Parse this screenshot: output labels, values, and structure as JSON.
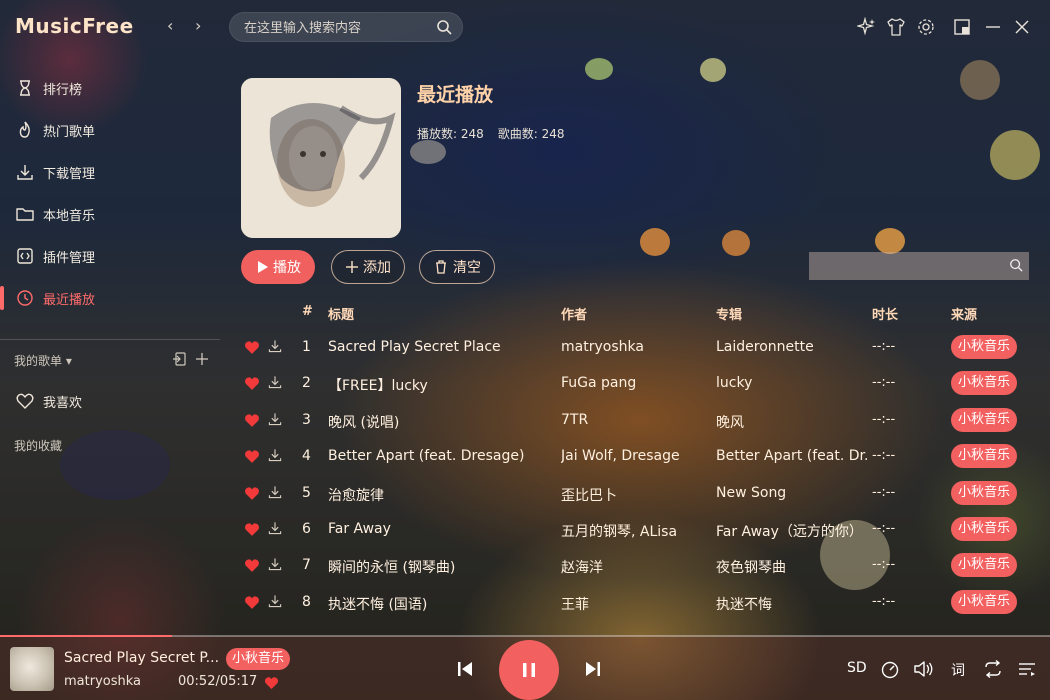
{
  "app": {
    "name": "MusicFree"
  },
  "header": {
    "search_placeholder": "在这里输入搜索内容",
    "icons": [
      "back-icon",
      "forward-icon",
      "sparkle-icon",
      "shirt-icon",
      "gear-icon",
      "minimize-to-window-icon",
      "minimize-icon",
      "close-icon"
    ]
  },
  "sidebar": {
    "items": [
      {
        "label": "排行榜",
        "icon": "hourglass-icon"
      },
      {
        "label": "热门歌单",
        "icon": "flame-icon"
      },
      {
        "label": "下载管理",
        "icon": "download-icon"
      },
      {
        "label": "本地音乐",
        "icon": "folder-icon"
      },
      {
        "label": "插件管理",
        "icon": "plugin-icon"
      },
      {
        "label": "最近播放",
        "icon": "clock-icon",
        "active": true
      }
    ],
    "my_playlists": "我的歌单",
    "favorites": "我喜欢",
    "my_collections": "我的收藏"
  },
  "playlist": {
    "title": "最近播放",
    "play_count_label": "播放数: 248",
    "song_count_label": "歌曲数: 248",
    "buttons": {
      "play": "播放",
      "add": "添加",
      "clear": "清空"
    }
  },
  "table": {
    "columns": {
      "index": "#",
      "title": "标题",
      "artist": "作者",
      "album": "专辑",
      "duration": "时长",
      "source": "来源"
    },
    "rows": [
      {
        "num": "1",
        "title": "Sacred Play Secret Place",
        "artist": "matryoshka",
        "album": "Laideronnette",
        "duration": "--:--",
        "source": "小秋音乐"
      },
      {
        "num": "2",
        "title": "【FREE】lucky",
        "artist": "FuGa pang",
        "album": "lucky",
        "duration": "--:--",
        "source": "小秋音乐"
      },
      {
        "num": "3",
        "title": "晚风 (说唱)",
        "artist": "7TR",
        "album": "晚风",
        "duration": "--:--",
        "source": "小秋音乐"
      },
      {
        "num": "4",
        "title": "Better Apart (feat. Dresage)",
        "artist": "Jai Wolf, Dresage",
        "album": "Better Apart (feat. Dr...",
        "duration": "--:--",
        "source": "小秋音乐"
      },
      {
        "num": "5",
        "title": "治愈旋律",
        "artist": "歪比巴卜",
        "album": "New Song",
        "duration": "--:--",
        "source": "小秋音乐"
      },
      {
        "num": "6",
        "title": "Far Away",
        "artist": "五月的钢琴, ALisa",
        "album": "Far Away（远方的你）",
        "duration": "--:--",
        "source": "小秋音乐"
      },
      {
        "num": "7",
        "title": "瞬间的永恒 (钢琴曲)",
        "artist": "赵海洋",
        "album": "夜色钢琴曲",
        "duration": "--:--",
        "source": "小秋音乐"
      },
      {
        "num": "8",
        "title": "执迷不悔 (国语)",
        "artist": "王菲",
        "album": "执迷不悔",
        "duration": "--:--",
        "source": "小秋音乐"
      }
    ]
  },
  "player": {
    "title": "Sacred Play Secret P...",
    "source": "小秋音乐",
    "artist": "matryoshka",
    "time": "00:52/05:17",
    "progress": 0.164,
    "quality": "SD",
    "lyric_label": "词"
  },
  "colors": {
    "accent": "#f2605f",
    "title": "#ffd2a8"
  }
}
